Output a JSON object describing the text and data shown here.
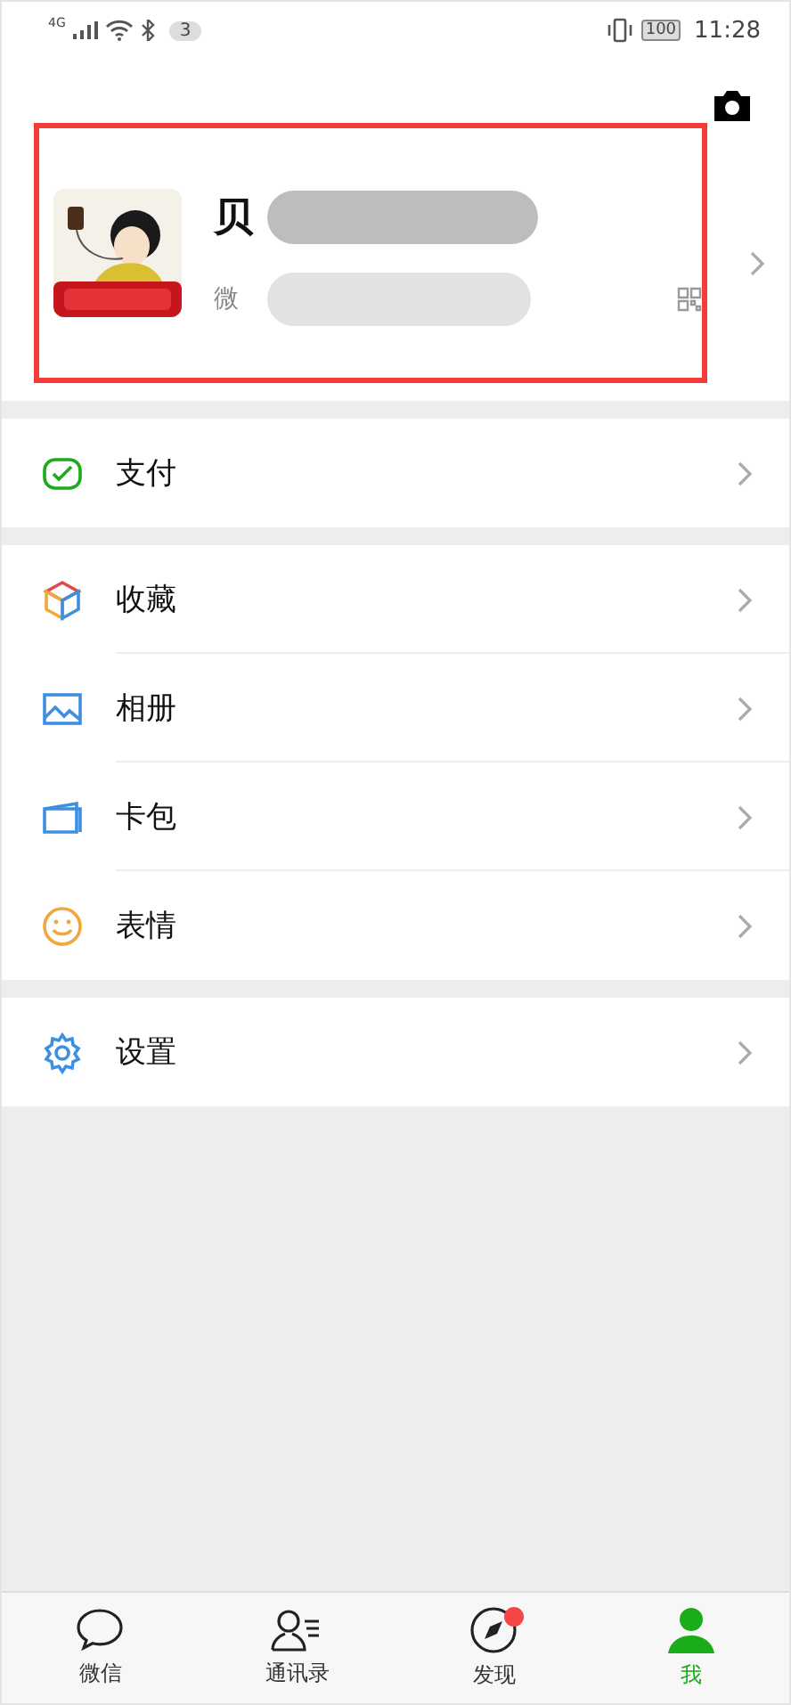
{
  "status_bar": {
    "network": "4G",
    "notification_count": "3",
    "battery": "100",
    "time": "11:28"
  },
  "profile": {
    "name": "贝",
    "id_label": "微",
    "annotated": true
  },
  "menu_groups": [
    {
      "items": [
        {
          "label": "支付",
          "kind": "pay"
        }
      ]
    },
    {
      "items": [
        {
          "label": "收藏",
          "kind": "favorites"
        },
        {
          "label": "相册",
          "kind": "album"
        },
        {
          "label": "卡包",
          "kind": "cards"
        },
        {
          "label": "表情",
          "kind": "stickers"
        }
      ]
    },
    {
      "items": [
        {
          "label": "设置",
          "kind": "settings"
        }
      ]
    }
  ],
  "tab_bar": [
    {
      "label": "微信",
      "kind": "chats",
      "selected": false,
      "badge": false
    },
    {
      "label": "通讯录",
      "kind": "contacts",
      "selected": false,
      "badge": false
    },
    {
      "label": "发现",
      "kind": "discover",
      "selected": false,
      "badge": true
    },
    {
      "label": "我",
      "kind": "me",
      "selected": true,
      "badge": false
    }
  ]
}
